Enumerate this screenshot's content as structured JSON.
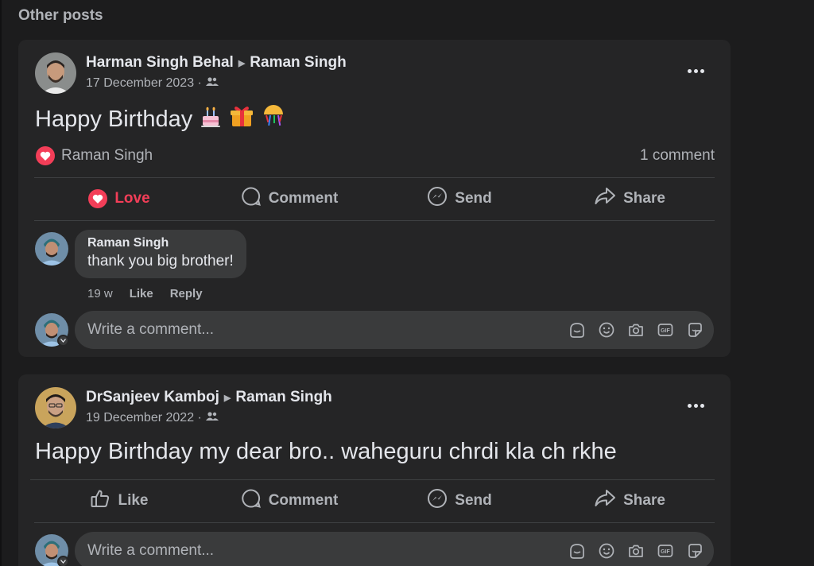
{
  "section": {
    "title": "Other posts"
  },
  "posts": [
    {
      "author": "Harman Singh Behal",
      "target": "Raman Singh",
      "date": "17 December 2023 ·",
      "text": "Happy Birthday ",
      "emojis": [
        "birthday-cake",
        "wrapped-gift",
        "confetti-ball"
      ],
      "reaction_by": "Raman Singh",
      "comment_count": "1 comment",
      "actions": {
        "react": "Love",
        "comment": "Comment",
        "send": "Send",
        "share": "Share"
      },
      "comment": {
        "author": "Raman Singh",
        "text": "thank you big brother!",
        "age": "19 w",
        "like": "Like",
        "reply": "Reply"
      },
      "write_placeholder": "Write a comment..."
    },
    {
      "author": "DrSanjeev Kamboj",
      "target": "Raman Singh",
      "date": "19 December 2022 ·",
      "text": "Happy Birthday my dear bro.. waheguru chrdi kla ch rkhe",
      "actions": {
        "react": "Like",
        "comment": "Comment",
        "send": "Send",
        "share": "Share"
      },
      "write_placeholder": "Write a comment..."
    }
  ],
  "colors": {
    "love": "#f33e58",
    "card": "#252526",
    "background": "#1c1c1d"
  }
}
